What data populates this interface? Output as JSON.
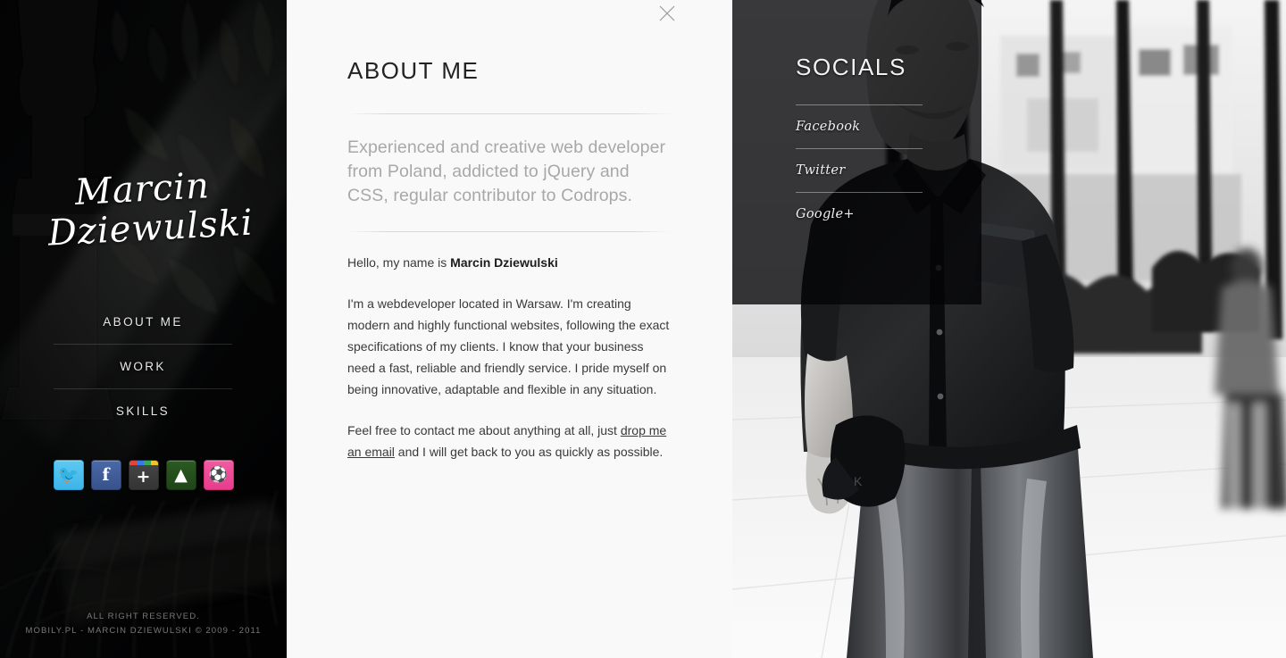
{
  "sidebar": {
    "logo_line1": "Marcin",
    "logo_line2": "Dziewulski",
    "nav": [
      {
        "label": "ABOUT ME",
        "name": "about-me"
      },
      {
        "label": "WORK",
        "name": "work"
      },
      {
        "label": "SKILLS",
        "name": "skills"
      }
    ],
    "social_icons": [
      {
        "name": "twitter-icon",
        "glyph": "❧",
        "label": "Twitter",
        "color": "#4fc1ef"
      },
      {
        "name": "facebook-icon",
        "glyph": "f",
        "label": "Facebook",
        "color": "#3f5a95"
      },
      {
        "name": "google-plus-icon",
        "glyph": "+",
        "label": "Google+",
        "color": "#3b3b3b"
      },
      {
        "name": "forrst-icon",
        "glyph": "❈",
        "label": "Forrst",
        "color": "#254d1c"
      },
      {
        "name": "dribbble-icon",
        "glyph": "⚽",
        "label": "Dribbble",
        "color": "#ea4c89"
      }
    ],
    "footer_line1": "ALL RIGHT RESERVED.",
    "footer_line2": "MOBILY.PL - MARCIN DZIEWULSKI © 2009 - 2011"
  },
  "main": {
    "title": "ABOUT ME",
    "close_label": "close-icon",
    "lead": "Experienced and creative web developer from Poland, addicted to jQuery and CSS, regular contributor to Codrops.",
    "greeting_prefix": "Hello, my name is ",
    "greeting_name": "Marcin Dziewulski",
    "paragraph_2": "I'm a webdeveloper located in Warsaw. I'm creating modern and highly functional websites, following the exact specifications of my clients. I know that your business need a fast, reliable and friendly service. I pride myself on being innovative, adaptable and flexible in any situation.",
    "paragraph_3_prefix": "Feel free to contact me about anything at all, just ",
    "paragraph_3_link": "drop me an email",
    "paragraph_3_suffix": " and I will get back to you as quickly as possible."
  },
  "socials": {
    "title": "SOCIALS",
    "links": [
      {
        "label": "Facebook",
        "name": "facebook"
      },
      {
        "label": "Twitter",
        "name": "twitter"
      },
      {
        "label": "Google+",
        "name": "google-plus"
      }
    ]
  },
  "colors": {
    "panel_bg": "#f9f9f9",
    "sidebar_bg": "#060607",
    "lead_text": "#a8a8a8",
    "body_text": "#3a3a3a",
    "overlay": "rgba(4,4,6,0.78)"
  }
}
